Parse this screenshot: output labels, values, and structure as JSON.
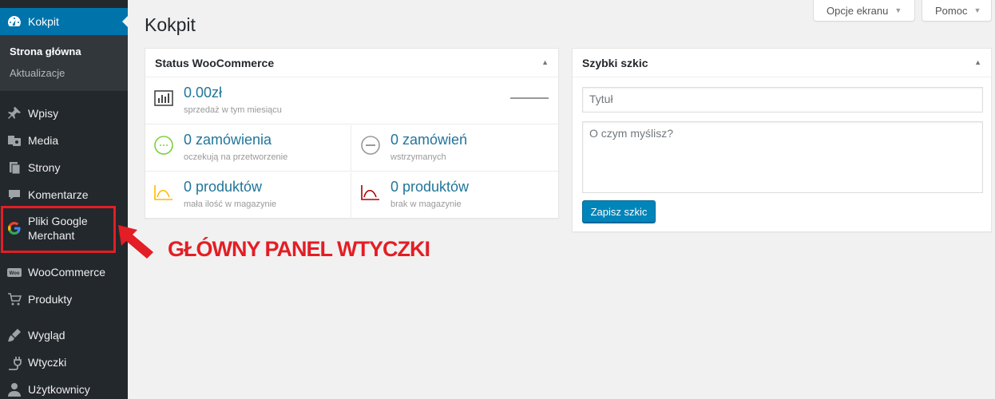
{
  "sidebar": {
    "current": {
      "label": "Kokpit",
      "icon": "dashboard-icon"
    },
    "submenu": [
      {
        "label": "Strona główna",
        "active": true
      },
      {
        "label": "Aktualizacje",
        "active": false
      }
    ],
    "items": [
      {
        "label": "Wpisy",
        "icon": "pin-icon"
      },
      {
        "label": "Media",
        "icon": "media-icon"
      },
      {
        "label": "Strony",
        "icon": "pages-icon"
      },
      {
        "label": "Komentarze",
        "icon": "comment-icon"
      },
      {
        "label": "Pliki Google Merchant",
        "line1": "Pliki Google",
        "line2": "Merchant",
        "icon": "google-icon"
      },
      {
        "label": "WooCommerce",
        "icon": "woocommerce-icon"
      },
      {
        "label": "Produkty",
        "icon": "cart-icon"
      },
      {
        "label": "Wygląd",
        "icon": "brush-icon"
      },
      {
        "label": "Wtyczki",
        "icon": "plug-icon"
      },
      {
        "label": "Użytkownicy",
        "icon": "user-icon"
      }
    ]
  },
  "header": {
    "screen_options": "Opcje ekranu",
    "help": "Pomoc",
    "title": "Kokpit"
  },
  "woocommerce_status": {
    "title": "Status WooCommerce",
    "sales": {
      "value": "0.00zł",
      "label": "sprzedaż w tym miesiącu"
    },
    "pending": {
      "value": "0 zamówienia",
      "label": "oczekują na przetworzenie"
    },
    "on_hold": {
      "value": "0 zamówień",
      "label": "wstrzymanych"
    },
    "low_stock": {
      "value": "0 produktów",
      "label": "mała ilość w magazynie"
    },
    "out_of_stock": {
      "value": "0 produktów",
      "label": "brak w magazynie"
    }
  },
  "quick_draft": {
    "title": "Szybki szkic",
    "title_placeholder": "Tytuł",
    "content_placeholder": "O czym myślisz?",
    "save_label": "Zapisz szkic"
  },
  "annotation": {
    "text": "GŁÓWNY PANEL WTYCZKI",
    "color": "#e31e24"
  },
  "colors": {
    "sidebar_bg": "#23282d",
    "accent": "#0073aa",
    "link": "#21759b"
  }
}
